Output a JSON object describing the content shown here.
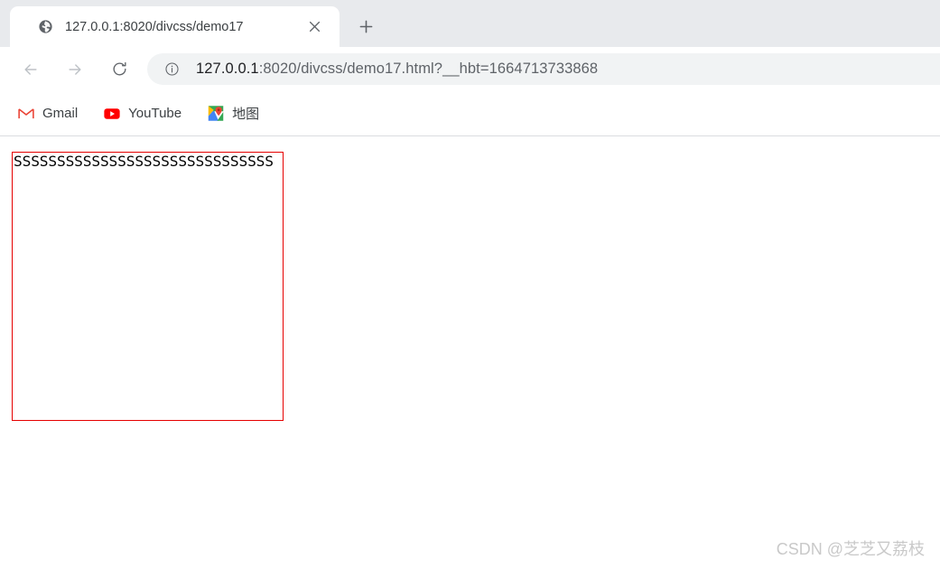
{
  "browser": {
    "tab": {
      "favicon": "globe-icon",
      "title": "127.0.0.1:8020/divcss/demo17",
      "close_label": "×"
    },
    "new_tab_label": "+",
    "nav": {
      "back_icon": "back-arrow-icon",
      "forward_icon": "forward-arrow-icon",
      "reload_icon": "reload-icon"
    },
    "omnibox": {
      "site_info_icon": "info-circle-icon",
      "url_host": "127.0.0.1",
      "url_rest": ":8020/divcss/demo17.html?__hbt=1664713733868",
      "url_full": "127.0.0.1:8020/divcss/demo17.html?__hbt=1664713733868"
    },
    "bookmarks": [
      {
        "label": "Gmail",
        "icon": "gmail-icon"
      },
      {
        "label": "YouTube",
        "icon": "youtube-icon"
      },
      {
        "label": "地图",
        "icon": "google-maps-icon"
      }
    ]
  },
  "page": {
    "box": {
      "text": "SSSSSSSSSSSSSSSSSSSSSSSSSSSSSS",
      "border_color": "#e60000"
    },
    "watermark": "CSDN @芝芝又荔枝"
  }
}
